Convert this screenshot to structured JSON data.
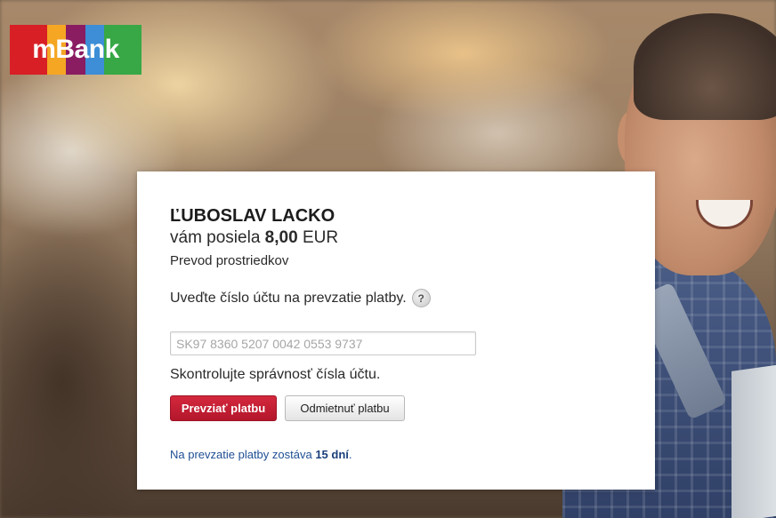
{
  "brand": {
    "logo_text": "mBank",
    "logo_stripes": [
      "#d81f26",
      "#d81f26",
      "#f5a623",
      "#8a1c62",
      "#3d8ed6",
      "#37a845",
      "#37a845"
    ]
  },
  "payment": {
    "sender_name": "ĽUBOSLAV LACKO",
    "amount_prefix": "vám posiela",
    "amount_value": "8,00",
    "currency": "EUR",
    "transfer_type": "Prevod prostriedkov"
  },
  "form": {
    "instruction": "Uveďte číslo účtu na prevzatie platby.",
    "help_icon_glyph": "?",
    "account_placeholder": "SK97 8360 5207 0042 0553 9737",
    "account_value": "",
    "verify_text": "Skontrolujte správnosť čísla účtu."
  },
  "actions": {
    "accept_label": "Prevziať platbu",
    "reject_label": "Odmietnuť platbu"
  },
  "deadline": {
    "prefix": "Na prevzatie platby zostáva",
    "days": "15 dní",
    "suffix": "."
  },
  "colors": {
    "accent_red": "#c41e34",
    "link_blue": "#1f4f93"
  }
}
